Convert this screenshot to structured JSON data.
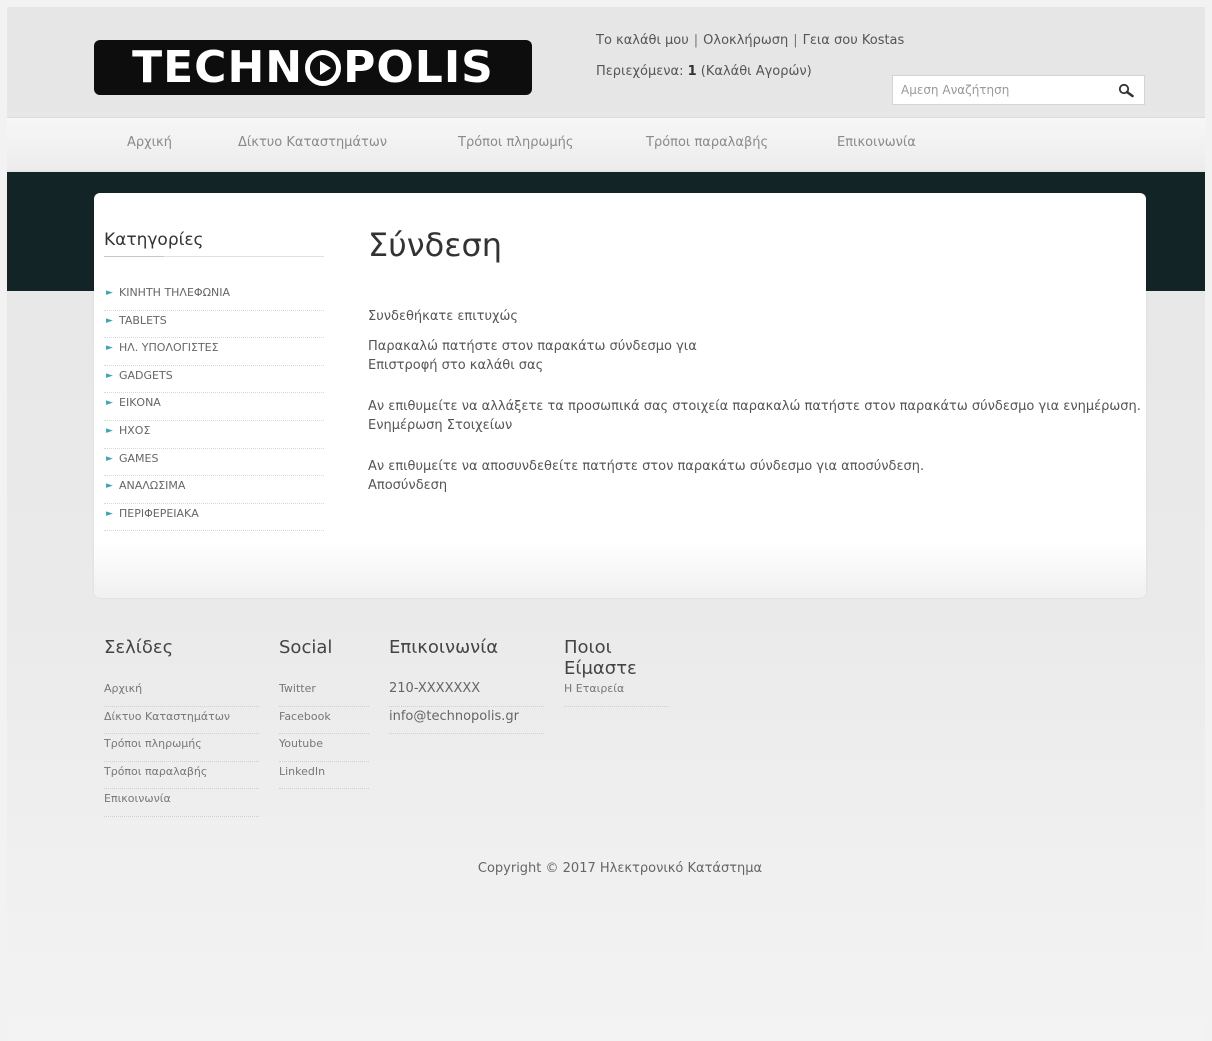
{
  "header": {
    "logo_text_left": "TECHN",
    "logo_text_right": "POLIS",
    "logo_o_icon": "play-circle-icon",
    "links": [
      "Το καλάθι μου",
      "Ολοκλήρωση",
      "Γεια σου Kostas"
    ],
    "separator": "|",
    "cart_label": "Περιεχόμενα:",
    "cart_count": "1",
    "cart_suffix": "(Καλάθι Αγορών)",
    "search_placeholder": "Αμεση Αναζήτηση",
    "search_icon": "magnifier-icon"
  },
  "nav": {
    "items": [
      "Αρχική",
      "Δίκτυο Καταστημάτων",
      "Τρόποι πληρωμής",
      "Τρόποι παραλαβής",
      "Επικοινωνία"
    ]
  },
  "sidebar": {
    "title": "Κατηγορίες",
    "arrow_glyph": "►",
    "categories": [
      "ΚΙΝΗΤΗ ΤΗΛΕΦΩΝΙΑ",
      "TABLETS",
      "ΗΛ. ΥΠΟΛΟΓΙΣΤΕΣ",
      "GADGETS",
      "ΕΙΚΟΝΑ",
      "ΗΧΟΣ",
      "GAMES",
      "ΑΝΑΛΩΣΙΜΑ",
      "ΠΕΡΙΦΕΡΕΙΑΚΑ"
    ]
  },
  "main": {
    "title": "Σύνδεση",
    "success": "Συνδεθήκατε επιτυχώς",
    "cart_prompt": "Παρακαλώ πατήστε στον παρακάτω σύνδεσμο για",
    "cart_link": "Επιστροφή στο καλάθι σας",
    "update_prompt": "Αν επιθυμείτε να αλλάξετε τα προσωπικά σας στοιχεία παρακαλώ πατήστε στον παρακάτω σύνδεσμο για ενημέρωση.",
    "update_link": "Ενημέρωση Στοιχείων",
    "logout_prompt": "Αν επιθυμείτε να αποσυνδεθείτε πατήστε στον παρακάτω σύνδεσμο για αποσύνδεση.",
    "logout_link": "Αποσύνδεση"
  },
  "footer": {
    "pages_title": "Σελίδες",
    "pages": [
      "Αρχική",
      "Δίκτυο Καταστημάτων",
      "Τρόποι πληρωμής",
      "Τρόποι παραλαβής",
      "Επικοινωνία"
    ],
    "social_title": "Social",
    "social": [
      "Twitter",
      "Facebook",
      "Youtube",
      "LinkedIn"
    ],
    "contact_title": "Επικοινωνία",
    "contact": [
      "210-XXXXXXX",
      "info@technopolis.gr"
    ],
    "about_title": "Ποιοι Είμαστε",
    "about": [
      "Η Εταιρεία"
    ],
    "copyright": "Copyright © 2017 Ηλεκτρονικό Κατάστημα"
  }
}
